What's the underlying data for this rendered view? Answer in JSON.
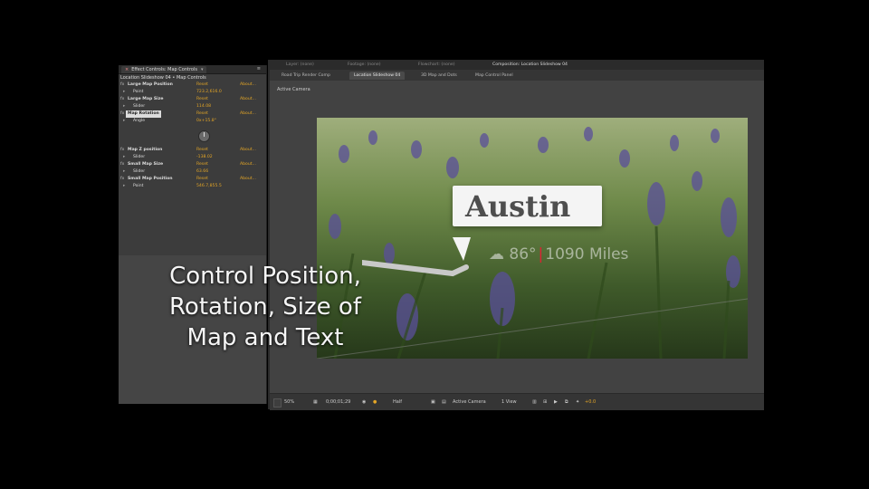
{
  "effect_controls": {
    "tab_label": "Effect Controls: Map Controls",
    "breadcrumb": "Location Slideshow 04 • Map Controls",
    "rows": [
      {
        "kind": "effect",
        "label": "Large Map Position",
        "reset": "Reset",
        "about": "About..."
      },
      {
        "kind": "param",
        "label": "Point",
        "value": "723.2,616.0"
      },
      {
        "kind": "effect",
        "label": "Large Map Size",
        "reset": "Reset",
        "about": "About..."
      },
      {
        "kind": "param",
        "label": "Slider",
        "value": "114.08"
      },
      {
        "kind": "effect",
        "label": "Map Rotation",
        "reset": "Reset",
        "about": "About...",
        "selected": true
      },
      {
        "kind": "param",
        "label": "Angle",
        "value": "0x+15.8°"
      },
      {
        "kind": "spacer"
      },
      {
        "kind": "spacer"
      },
      {
        "kind": "spacer"
      },
      {
        "kind": "effect",
        "label": "Map Z position",
        "reset": "Reset",
        "about": "About..."
      },
      {
        "kind": "param",
        "label": "Slider",
        "value": "-138.02"
      },
      {
        "kind": "effect",
        "label": "Small Map Size",
        "reset": "Reset",
        "about": "About..."
      },
      {
        "kind": "param",
        "label": "Slider",
        "value": "63.66"
      },
      {
        "kind": "effect",
        "label": "Small Map Position",
        "reset": "Reset",
        "about": "About..."
      },
      {
        "kind": "param",
        "label": "Point",
        "value": "546.7,855.5"
      }
    ]
  },
  "top_tabs": [
    "Layer: (none)",
    "Footage: (none)",
    "Flowchart: (none)",
    "Composition: Location Slideshow 04"
  ],
  "comp_tabs": [
    "Road Trip Render Comp",
    "Location Slideshow 04",
    "3D Map and Dots",
    "Map Control Panel"
  ],
  "viewer": {
    "active_camera_label": "Active Camera",
    "callout_title": "Austin",
    "temperature": "86°",
    "distance": "1090 Miles"
  },
  "bottom_bar": {
    "zoom": "50%",
    "timecode": "0;00;01;29",
    "resolution": "Half",
    "camera": "Active Camera",
    "view": "1 View",
    "exposure": "+0.0"
  },
  "overlay_text": [
    "Control Position,",
    "Rotation, Size of",
    "Map and Text"
  ],
  "colors": {
    "accent": "#e3a526",
    "panel": "#3c3c3c",
    "background": "#000000"
  }
}
